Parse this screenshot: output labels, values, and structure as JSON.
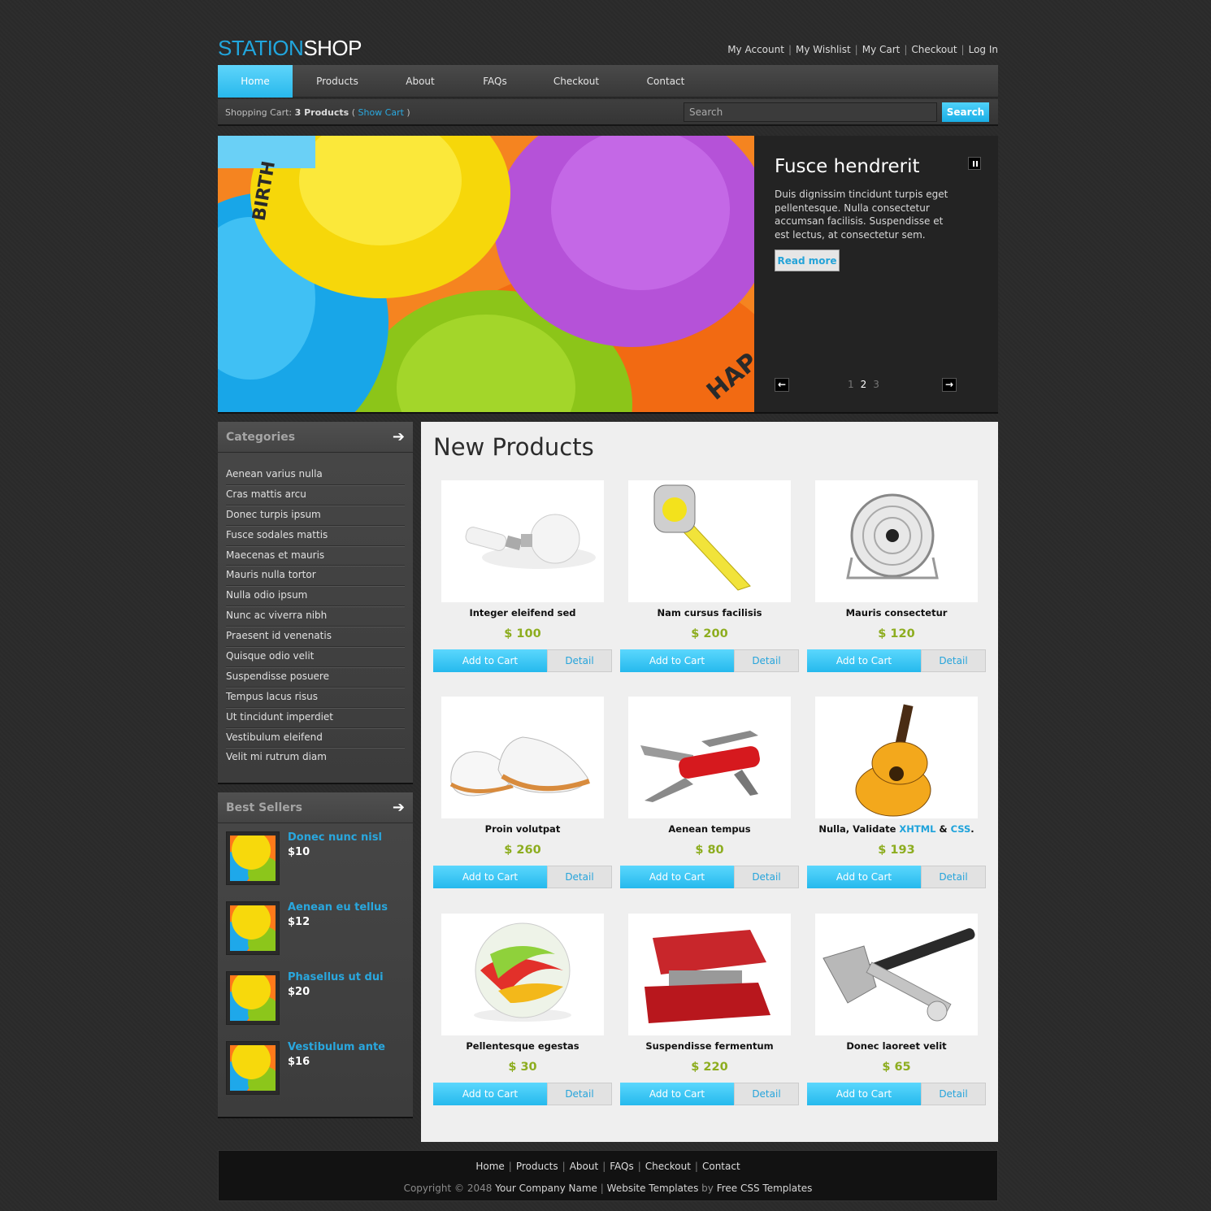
{
  "logo": {
    "part1": "STATION",
    "part2": "SHOP"
  },
  "top_links": [
    "My Account",
    "My Wishlist",
    "My Cart",
    "Checkout",
    "Log In"
  ],
  "nav": [
    "Home",
    "Products",
    "About",
    "FAQs",
    "Checkout",
    "Contact"
  ],
  "cart": {
    "label": "Shopping Cart:",
    "count": "3 Products",
    "open": "(",
    "show": "Show Cart",
    "close": ")"
  },
  "search": {
    "placeholder": "Search",
    "button": "Search"
  },
  "slider": {
    "title": "Fusce hendrerit",
    "text": "Duis dignissim tincidunt turpis eget pellentesque. Nulla consectetur accumsan facilisis. Suspendisse et est lectus, at consectetur sem.",
    "read_more": "Read more",
    "pages": [
      "1",
      "2",
      "3"
    ],
    "current_page": "2"
  },
  "categories": {
    "title": "Categories",
    "items": [
      "Aenean varius nulla",
      "Cras mattis arcu",
      "Donec turpis ipsum",
      "Fusce sodales mattis",
      "Maecenas et mauris",
      "Mauris nulla tortor",
      "Nulla odio ipsum",
      "Nunc ac viverra nibh",
      "Praesent id venenatis",
      "Quisque odio velit",
      "Suspendisse posuere",
      "Tempus lacus risus",
      "Ut tincidunt imperdiet",
      "Vestibulum eleifend",
      "Velit mi rutrum diam"
    ]
  },
  "best_sellers": {
    "title": "Best Sellers",
    "items": [
      {
        "name": "Donec nunc nisl",
        "price": "$10"
      },
      {
        "name": "Aenean eu tellus",
        "price": "$12"
      },
      {
        "name": "Phasellus ut dui",
        "price": "$20"
      },
      {
        "name": "Vestibulum ante",
        "price": "$16"
      }
    ]
  },
  "main": {
    "title": "New Products",
    "add_label": "Add to Cart",
    "detail_label": "Detail",
    "products": [
      {
        "name": "Integer eleifend sed",
        "price": "$ 100",
        "image": "light-bulbs"
      },
      {
        "name": "Nam cursus facilisis",
        "price": "$ 200",
        "image": "tape-measure"
      },
      {
        "name": "Mauris consectetur",
        "price": "$ 120",
        "image": "desk-fan"
      },
      {
        "name": "Proin volutpat",
        "price": "$ 260",
        "image": "white-shoes"
      },
      {
        "name": "Aenean tempus",
        "price": "$ 80",
        "image": "pocket-knife"
      },
      {
        "name_prefix": "Nulla, Validate",
        "link1": "XHTML",
        "amp": "&",
        "link2": "CSS",
        "dot": ".",
        "price": "$ 193",
        "image": "acoustic-guitar"
      },
      {
        "name": "Pellentesque egestas",
        "price": "$ 30",
        "image": "glass-marble"
      },
      {
        "name": "Suspendisse fermentum",
        "price": "$ 220",
        "image": "red-stapler"
      },
      {
        "name": "Donec laoreet velit",
        "price": "$ 65",
        "image": "hammer-wrench"
      }
    ]
  },
  "footer": {
    "links": [
      "Home",
      "Products",
      "About",
      "FAQs",
      "Checkout",
      "Contact"
    ],
    "copyright": "Copyright © 2048",
    "company": "Your Company Name",
    "templates": "Website Templates",
    "by": "by",
    "fct": "Free CSS Templates"
  },
  "colors": {
    "accent": "#21a6dd",
    "price": "#8dad1f"
  }
}
